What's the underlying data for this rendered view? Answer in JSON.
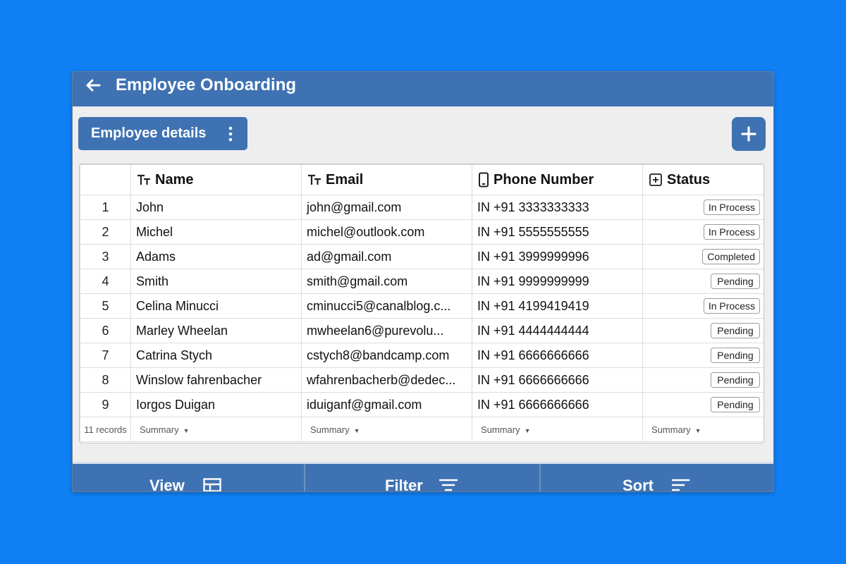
{
  "header": {
    "title": "Employee Onboarding",
    "back_icon": "back-arrow-icon"
  },
  "toolbar": {
    "view_name": "Employee details",
    "more_icon": "kebab-menu-icon",
    "add_icon": "plus-icon"
  },
  "table": {
    "columns": [
      {
        "label": "Name",
        "icon": "text-type-icon"
      },
      {
        "label": "Email",
        "icon": "text-type-icon"
      },
      {
        "label": "Phone Number",
        "icon": "phone-icon"
      },
      {
        "label": "Status",
        "icon": "select-box-icon"
      }
    ],
    "rows": [
      {
        "num": "1",
        "name": "John",
        "email": "john@gmail.com",
        "phone": "IN +91 3333333333",
        "status": "In Process"
      },
      {
        "num": "2",
        "name": "Michel",
        "email": "michel@outlook.com",
        "phone": "IN +91 5555555555",
        "status": "In Process"
      },
      {
        "num": "3",
        "name": "Adams",
        "email": "ad@gmail.com",
        "phone": "IN +91 3999999996",
        "status": "Completed"
      },
      {
        "num": "4",
        "name": "Smith",
        "email": "smith@gmail.com",
        "phone": "IN +91 9999999999",
        "status": "Pending"
      },
      {
        "num": "5",
        "name": "Celina Minucci",
        "email": "cminucci5@canalblog.c...",
        "phone": "IN +91 4199419419",
        "status": "In Process"
      },
      {
        "num": "6",
        "name": "Marley Wheelan",
        "email": "mwheelan6@purevolu...",
        "phone": "IN +91 4444444444",
        "status": "Pending"
      },
      {
        "num": "7",
        "name": "Catrina Stych",
        "email": "cstych8@bandcamp.com",
        "phone": "IN +91 6666666666",
        "status": "Pending"
      },
      {
        "num": "8",
        "name": "Winslow fahrenbacher",
        "email": "wfahrenbacherb@dedec...",
        "phone": "IN +91 6666666666",
        "status": "Pending"
      },
      {
        "num": "9",
        "name": "Iorgos Duigan",
        "email": "iduiganf@gmail.com",
        "phone": "IN +91 6666666666",
        "status": "Pending"
      }
    ],
    "record_count": "11 records",
    "summary_label": "Summary"
  },
  "bottom_bar": {
    "view_label": "View",
    "filter_label": "Filter",
    "sort_label": "Sort"
  },
  "colors": {
    "accent": "#3f72b2",
    "background": "#0f7ff3"
  }
}
